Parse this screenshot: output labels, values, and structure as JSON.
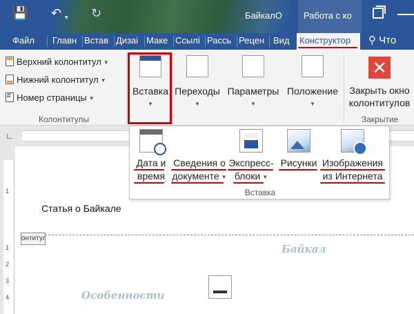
{
  "titlebar": {
    "doc_title": "БайкалО",
    "context_title": "Работа с ко",
    "save_icon": "save-icon",
    "undo_icon": "undo-icon",
    "redo_icon": "redo-icon"
  },
  "tabs": {
    "file": "Файл",
    "items": [
      "Главн",
      "Встав",
      "Дизаі",
      "Маке",
      "Ссылі",
      "Рассь",
      "Рецен",
      "Вид"
    ],
    "active": "Конструктор",
    "search_icon": "lightbulb-icon"
  },
  "ribbon": {
    "header_label": "Верхний колонтитул",
    "footer_label": "Нижний колонтитул",
    "page_number_label": "Номер страницы",
    "group_headers_footers": "Колонтитулы",
    "insert_label": "Вставка",
    "navigation_label": "Переходы",
    "options_label": "Параметры",
    "position_label": "Положение",
    "close_label_1": "Закрыть окно",
    "close_label_2": "колонтитулов",
    "group_close": "Закрытие"
  },
  "panel": {
    "date_1": "Дата и",
    "date_2": "время",
    "docinfo_1": "Сведения о",
    "docinfo_2": "документе",
    "quickparts_1": "Экспресс-",
    "quickparts_2": "блоки",
    "pictures": "Рисунки",
    "online_1": "Изображения",
    "online_2": "из Интернета",
    "group_label": "Вставка"
  },
  "document": {
    "body_text": "Статья о Байкале",
    "footer_tag": "онтитул",
    "watermark_1": "Байкал",
    "watermark_2": "Особенности"
  },
  "vruler": [
    "1",
    "1",
    "2",
    "3",
    "4"
  ],
  "colors": {
    "ribbon_blue": "#2b579a",
    "highlight_red": "#d60000"
  }
}
